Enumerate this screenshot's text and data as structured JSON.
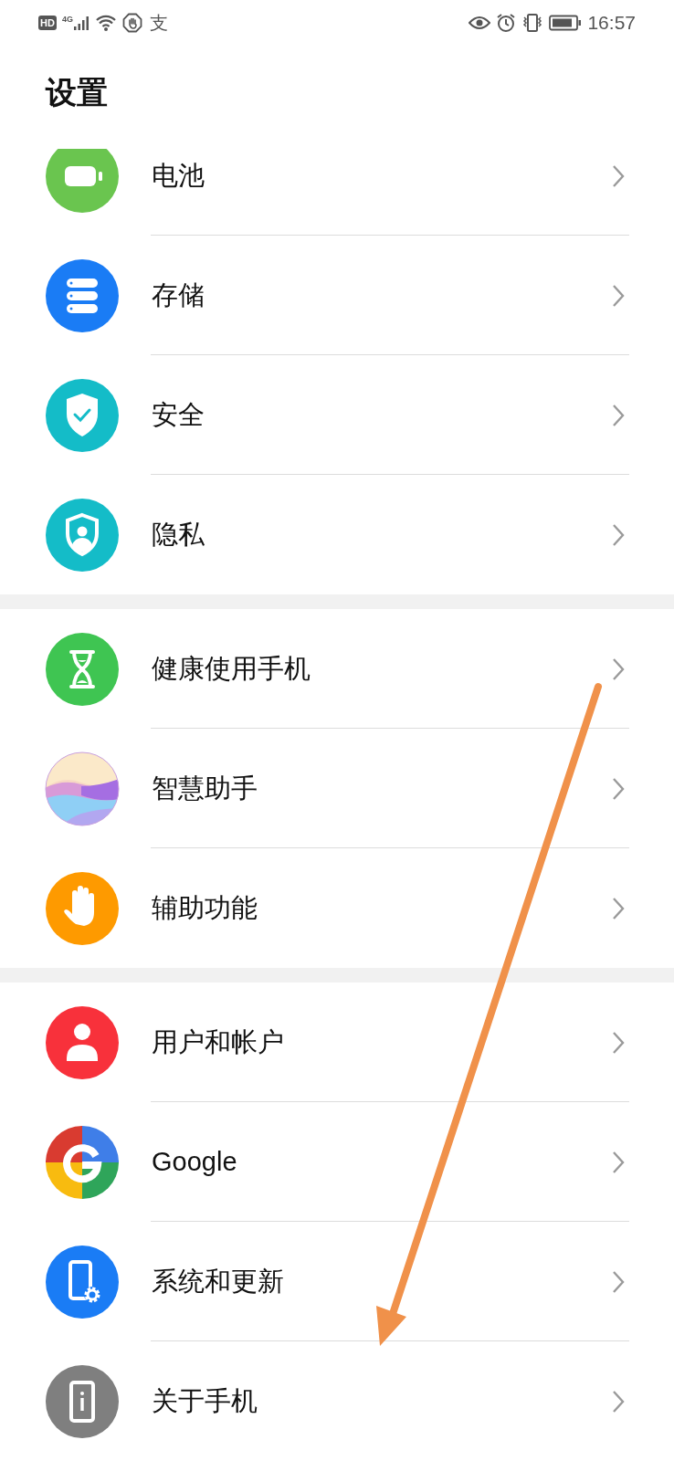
{
  "status_bar": {
    "left": {
      "hd": "HD",
      "network": "4G",
      "app_glyph": "支"
    },
    "time": "16:57"
  },
  "title": "设置",
  "groups": [
    {
      "items": [
        {
          "label": "电池"
        },
        {
          "label": "存储"
        },
        {
          "label": "安全"
        },
        {
          "label": "隐私"
        }
      ]
    },
    {
      "items": [
        {
          "label": "健康使用手机"
        },
        {
          "label": "智慧助手"
        },
        {
          "label": "辅助功能"
        }
      ]
    },
    {
      "items": [
        {
          "label": "用户和帐户"
        },
        {
          "label": "Google"
        },
        {
          "label": "系统和更新"
        },
        {
          "label": "关于手机"
        }
      ]
    }
  ],
  "annotations": [
    {
      "kind": "arrow"
    }
  ]
}
